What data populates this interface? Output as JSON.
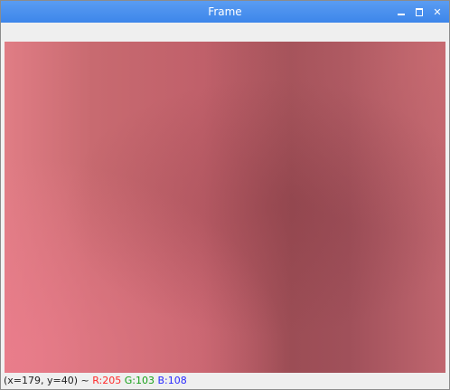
{
  "window": {
    "title": "Frame"
  },
  "controls": {
    "minimize_icon": "minimize-icon",
    "maximize_icon": "maximize-icon",
    "close_icon": "close-icon",
    "close_glyph": "✕"
  },
  "status": {
    "coords": "(x=179, y=40)",
    "separator": "~",
    "r": "R:205",
    "g": "G:103",
    "b": "B:108"
  },
  "colors": {
    "titlebar": "#4a90ee",
    "r_text": "#ff2a2a",
    "g_text": "#18a018",
    "b_text": "#2a2aff",
    "image_base": "#cd676c"
  }
}
